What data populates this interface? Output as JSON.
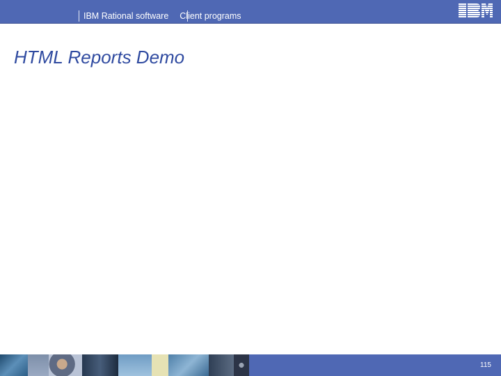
{
  "header": {
    "product": "IBM Rational software",
    "section": "Client programs",
    "logo_text": "IBM"
  },
  "slide": {
    "title": "HTML Reports Demo"
  },
  "footer": {
    "page_number": "115"
  },
  "colors": {
    "header_bg": "#4f68b4",
    "title_text": "#2f4aa0",
    "footer_bg": "#4f68b4"
  }
}
